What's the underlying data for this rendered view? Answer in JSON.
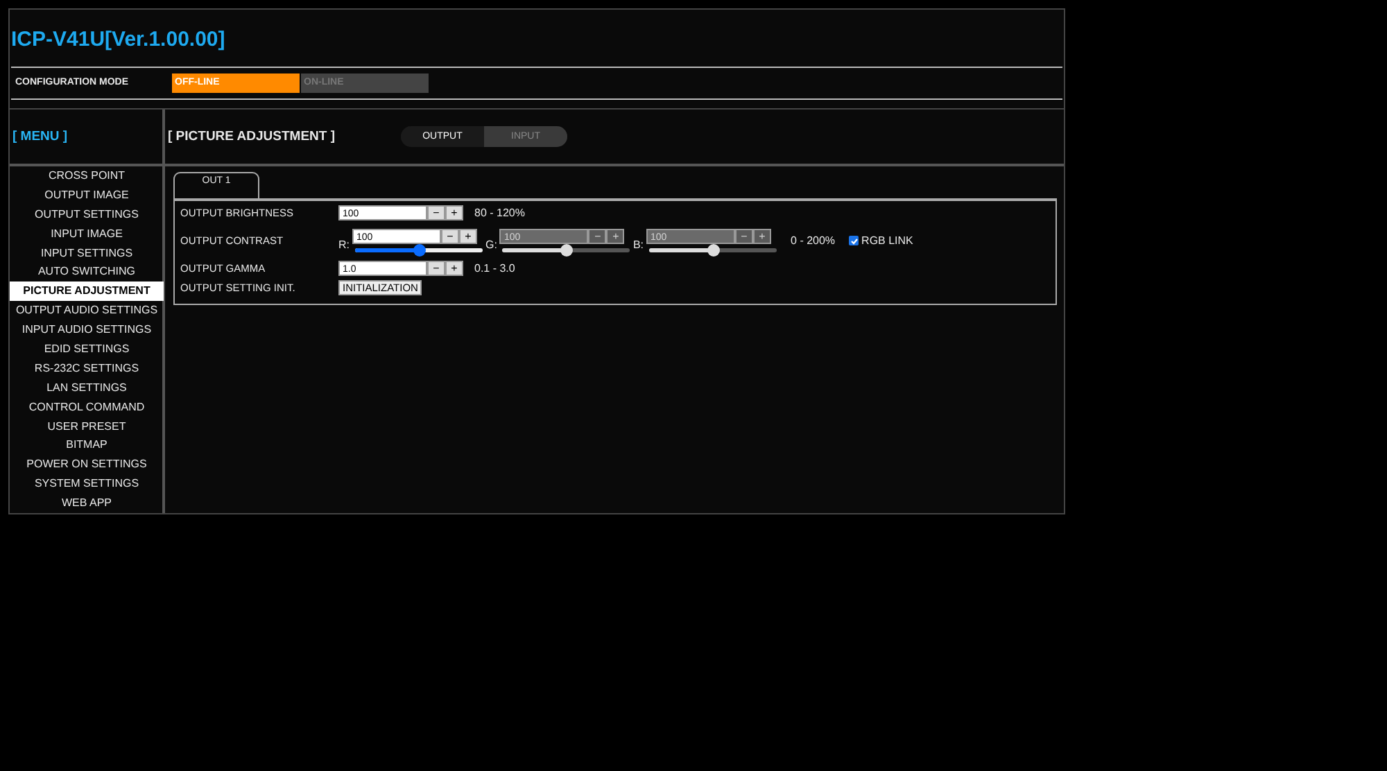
{
  "header": {
    "title": "ICP-V41U[Ver.1.00.00]"
  },
  "config_mode": {
    "label": "CONFIGURATION MODE",
    "options": [
      {
        "label": "OFF-LINE",
        "selected": true
      },
      {
        "label": "ON-LINE",
        "selected": false
      }
    ]
  },
  "menu": {
    "title": "[ MENU ]",
    "items": [
      {
        "label": "CROSS POINT",
        "selected": false
      },
      {
        "label": "OUTPUT IMAGE",
        "selected": false
      },
      {
        "label": "OUTPUT SETTINGS",
        "selected": false
      },
      {
        "label": "INPUT IMAGE",
        "selected": false
      },
      {
        "label": "INPUT SETTINGS",
        "selected": false
      },
      {
        "label": "AUTO SWITCHING",
        "selected": false
      },
      {
        "label": "PICTURE ADJUSTMENT",
        "selected": true
      },
      {
        "label": "OUTPUT AUDIO SETTINGS",
        "selected": false
      },
      {
        "label": "INPUT AUDIO SETTINGS",
        "selected": false
      },
      {
        "label": "EDID SETTINGS",
        "selected": false
      },
      {
        "label": "RS-232C SETTINGS",
        "selected": false
      },
      {
        "label": "LAN SETTINGS",
        "selected": false
      },
      {
        "label": "CONTROL COMMAND",
        "selected": false
      },
      {
        "label": "USER PRESET",
        "selected": false
      },
      {
        "label": "BITMAP",
        "selected": false
      },
      {
        "label": "POWER ON SETTINGS",
        "selected": false
      },
      {
        "label": "SYSTEM SETTINGS",
        "selected": false
      },
      {
        "label": "WEB APP",
        "selected": false
      }
    ]
  },
  "page": {
    "title": "[ PICTURE ADJUSTMENT ]",
    "toggle": [
      {
        "label": "OUTPUT",
        "selected": true
      },
      {
        "label": "INPUT",
        "selected": false
      }
    ],
    "tabs": [
      {
        "label": "OUT 1",
        "selected": true
      }
    ],
    "rows": [
      {
        "kind": "spinner",
        "label": "OUTPUT BRIGHTNESS",
        "value": "100",
        "minus": "−",
        "plus": "+",
        "range": "80 - 120%"
      },
      {
        "kind": "rgb",
        "label": "OUTPUT CONTRAST",
        "channels": [
          {
            "label": "R:",
            "value": "100",
            "minus": "−",
            "plus": "+",
            "level": 0.5,
            "disabled": false
          },
          {
            "label": "G:",
            "value": "100",
            "minus": "−",
            "plus": "+",
            "level": 0.5,
            "disabled": true
          },
          {
            "label": "B:",
            "value": "100",
            "minus": "−",
            "plus": "+",
            "level": 0.5,
            "disabled": true
          }
        ],
        "range": "0 - 200%",
        "link": {
          "label": "RGB LINK",
          "checked": true
        }
      },
      {
        "kind": "spinner",
        "label": "OUTPUT GAMMA",
        "value": "1.0",
        "minus": "−",
        "plus": "+",
        "range": "0.1 - 3.0"
      },
      {
        "kind": "button",
        "label": "OUTPUT SETTING INIT.",
        "button": "INITIALIZATION"
      }
    ]
  }
}
